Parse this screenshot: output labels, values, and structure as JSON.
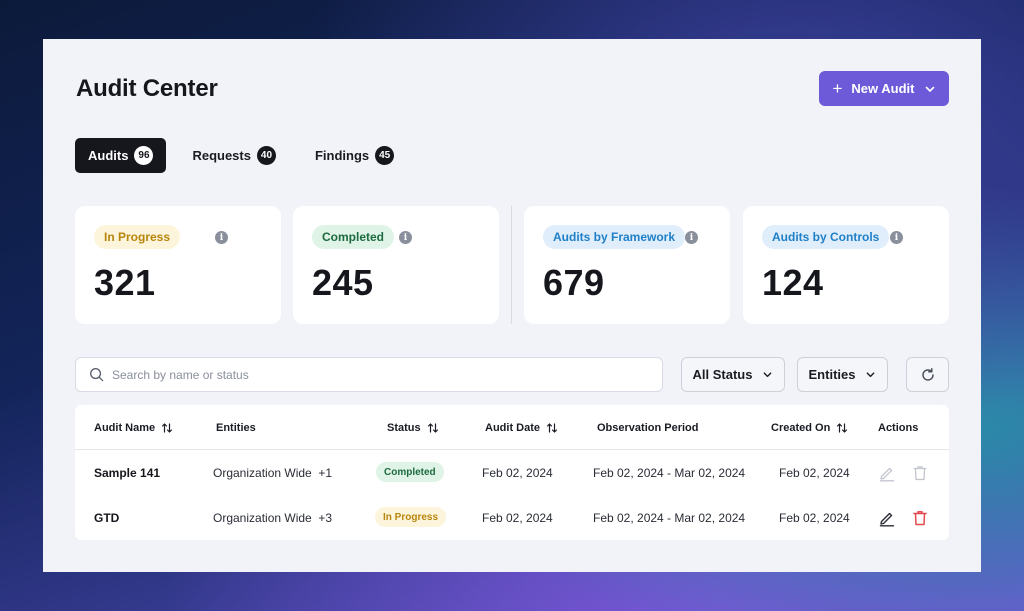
{
  "page": {
    "title": "Audit Center"
  },
  "new_audit": {
    "label": "New Audit",
    "plus": "+"
  },
  "tabs": [
    {
      "label": "Audits",
      "count": "96",
      "active": true
    },
    {
      "label": "Requests",
      "count": "40"
    },
    {
      "label": "Findings",
      "count": "45"
    }
  ],
  "stats": [
    {
      "label": "In Progress",
      "value": "321",
      "color": "#b7860b",
      "bg": "#fdf4dc"
    },
    {
      "label": "Completed",
      "value": "245",
      "color": "#1d6b3f",
      "bg": "#dff3e6"
    },
    {
      "label": "Audits by Framework",
      "value": "679",
      "color": "#1f7fc7",
      "bg": "#e0eefb"
    },
    {
      "label": "Audits by Controls",
      "value": "124",
      "color": "#1f7fc7",
      "bg": "#e0eefb"
    }
  ],
  "stat_info_glyph": "i",
  "search": {
    "placeholder": "Search by name or status"
  },
  "filters": {
    "status": "All Status",
    "entities": "Entities"
  },
  "table": {
    "headers": [
      "Audit Name",
      "Entities",
      "Status",
      "Audit Date",
      "Observation Period",
      "Created On",
      "Actions"
    ],
    "rows": [
      {
        "name": "Sample 141",
        "entities": "Organization Wide",
        "extra": "+1",
        "status": "Completed",
        "audit_date": "Feb 02, 2024",
        "period": "Feb 02, 2024 - Mar 02, 2024",
        "created": "Feb 02, 2024",
        "actions_enabled": false
      },
      {
        "name": "GTD",
        "entities": "Organization Wide",
        "extra": "+3",
        "status": "In Progress",
        "audit_date": "Feb 02, 2024",
        "period": "Feb 02, 2024 - Mar 02, 2024",
        "created": "Feb 02, 2024",
        "actions_enabled": true
      }
    ]
  },
  "colors": {
    "accent": "#6c5ad9",
    "delete": "#e5484d",
    "dark": "#15171d"
  }
}
